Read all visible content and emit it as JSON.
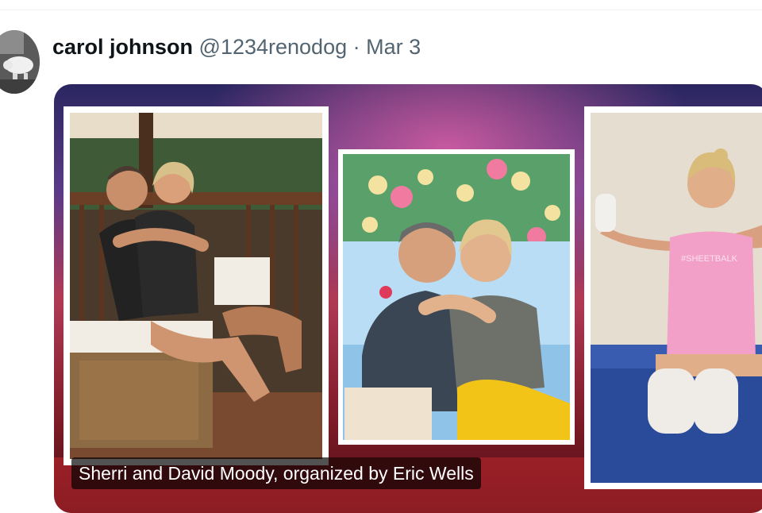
{
  "tweet": {
    "author_name": "carol johnson",
    "handle": "@1234renodog",
    "separator": "·",
    "date": "Mar 3"
  },
  "media": {
    "caption": "Sherri and David Moody, organized by Eric Wells",
    "photos": [
      {
        "name": "couple-on-porch-photo"
      },
      {
        "name": "couple-tropical-backdrop-photo"
      },
      {
        "name": "woman-pink-tank-photo"
      }
    ],
    "shirt_text": "#SHEETBALK"
  },
  "colors": {
    "name": "#0f1419",
    "secondary": "#536471",
    "caption_bg": "#000000",
    "pink_top": "#f2a0c8"
  }
}
